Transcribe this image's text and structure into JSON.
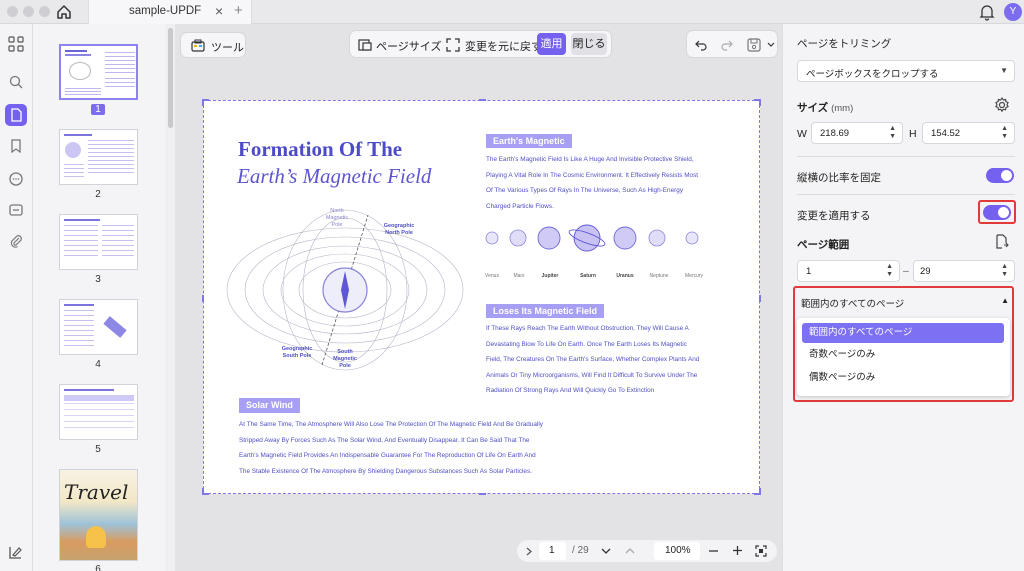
{
  "titlebar": {
    "tab_title": "sample-UPDF",
    "tab_close": "×",
    "tab_add": "+",
    "avatar_letter": "Y"
  },
  "thumbnails": {
    "page_labels": [
      "1",
      "2",
      "3",
      "4",
      "5",
      "6"
    ],
    "page6_word": "Travel"
  },
  "toolbar": {
    "tools_label": "ツール",
    "page_size_label": "ページサイズ",
    "revert_label": "変更を元に戻す",
    "apply_label": "適用",
    "close_label": "閉じる"
  },
  "document": {
    "title_line1": "Formation Of The",
    "title_line2": "Earth’s Magnetic Field",
    "section1_heading": "Earth's Magnetic",
    "section1_lines": [
      "The Earth's Magnetic Field Is Like A Huge And Invisible Protective Shield,",
      "Playing A Vital Role In The Cosmic Environment. It Effectively Resists Most",
      "Of The Various Types Of Rays In The Universe, Such As High-Energy",
      "Charged Particle Flows."
    ],
    "planets": [
      "Venus",
      "Mars",
      "Jupiter",
      "Saturn",
      "Uranus",
      "Neptune",
      "Mercury"
    ],
    "section2_heading": "Loses Its Magnetic Field",
    "section2_lines": [
      "If These Rays Reach The Earth Without Obstruction, They Will Cause A",
      "Devastating Blow To Life On Earth. Once The Earth Loses Its Magnetic",
      "Field, The Creatures On The Earth's Surface, Whether Complex Plants And",
      "Animals Or Tiny Microorganisms, Will Find It Difficult To Survive Under The",
      "Radiation Of Strong Rays And Will Quickly Go To Extinction"
    ],
    "section3_heading": "Solar Wind",
    "section3_lines": [
      "At The Same Time, The Atmosphere Will Also Lose The Protection Of The Magnetic Field And Be Gradually",
      "Stripped Away By Forces Such As The Solar Wind, And Eventually Disappear. It Can Be Said That The",
      "Earth's Magnetic Field Provides An Indispensable Guarantee For The Reproduction Of Life On Earth And",
      "The Stable Existence Of The Atmosphere By Shielding Dangerous Substances Such As Solar Particles."
    ],
    "diagram_labels": {
      "north_magnetic": "North\nMagnetic Pole",
      "geo_north": "Geographic\nNorth Pole",
      "geo_south": "Geographic\nSouth Pole",
      "south_magnetic": "South\nMagnetic\nPole"
    }
  },
  "navigation": {
    "current_page": "1",
    "separator_total": "/ 29",
    "zoom": "100%"
  },
  "panel": {
    "crop_title": "ページをトリミング",
    "crop_mode": "ページボックスをクロップする",
    "size_label": "サイズ",
    "size_unit": "(mm)",
    "width_label": "W",
    "width_value": "218.69",
    "height_label": "H",
    "height_value": "154.52",
    "aspect_label": "縦横の比率を固定",
    "apply_changes_label": "変更を適用する",
    "range_label": "ページ範囲",
    "range_from": "1",
    "range_dash": "–",
    "range_to": "29",
    "range_select": "範囲内のすべてのページ",
    "range_options": [
      "範囲内のすべてのページ",
      "奇数ページのみ",
      "偶数ページのみ"
    ]
  },
  "colors": {
    "accent": "#7461F0",
    "highlight": "#E03A3A",
    "doc_text": "#4F4FC6"
  }
}
